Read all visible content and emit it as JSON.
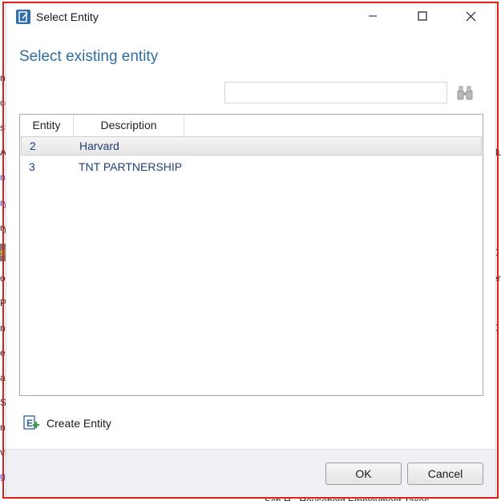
{
  "background_fragments": {
    "left": [
      "nc",
      "co",
      "st",
      "A",
      "nd",
      "ry",
      "ry",
      "st",
      "or",
      "Pa",
      "n",
      "et",
      "al",
      "S",
      "ne",
      "vi",
      "g"
    ],
    "right": [
      "du",
      "D",
      "en",
      "D"
    ],
    "bottom": "Sch H - Household Employment Taxes"
  },
  "window": {
    "title": "Select Entity",
    "controls": {
      "minimize": "minimize",
      "maximize": "maximize",
      "close": "close"
    }
  },
  "heading": "Select existing entity",
  "search": {
    "value": "",
    "placeholder": "",
    "button_icon": "binoculars-icon"
  },
  "grid": {
    "columns": [
      "Entity",
      "Description"
    ],
    "rows": [
      {
        "entity": "2",
        "description": "Harvard",
        "selected": true
      },
      {
        "entity": "3",
        "description": "TNT PARTNERSHIP",
        "selected": false
      }
    ]
  },
  "create_entity": {
    "label": "Create Entity",
    "icon": "create-entity-icon"
  },
  "buttons": {
    "ok": "OK",
    "cancel": "Cancel"
  },
  "colors": {
    "heading": "#2e6fa3",
    "row_text": "#1d3f78",
    "selection_frame": "#e01e1e",
    "footer": "#f0f0f5"
  }
}
